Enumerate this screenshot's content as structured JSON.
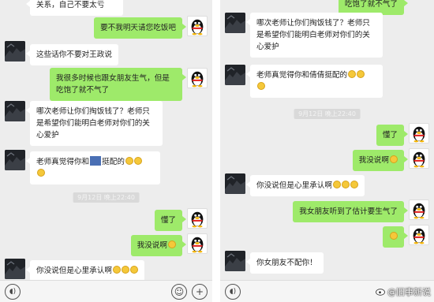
{
  "left": {
    "top_partial": "关系，自己不要太亏",
    "messages": [
      {
        "side": "right",
        "text": "要不我明天请您吃饭吧"
      },
      {
        "side": "left",
        "text": "这些话你不要对王政说"
      },
      {
        "side": "right",
        "text": "我很多时候也跟女朋友生气，但是吃饱了就不气了"
      },
      {
        "side": "left",
        "text": "哪次老师让你们掏饭钱了？老师只是希望你们能明白老师对你们的关心爱护"
      },
      {
        "side": "left",
        "text_a": "老师真觉得你和",
        "text_b": "挺配的"
      },
      {
        "side": "right",
        "text": "懂了"
      },
      {
        "side": "right",
        "text": "我没说啊"
      },
      {
        "side": "left",
        "text": "你没说但是心里承认啊"
      }
    ],
    "timestamp": "9月12日 晚上22:40"
  },
  "right": {
    "top_partial": "吃饱了就不气了",
    "messages": [
      {
        "side": "left",
        "text": "哪次老师让你们掏饭钱了？老师只是希望你们能明白老师对你们的关心爱护"
      },
      {
        "side": "left",
        "text": "老师真觉得你和倩倩挺配的"
      },
      {
        "side": "right",
        "text": "懂了"
      },
      {
        "side": "right",
        "text": "我没说啊"
      },
      {
        "side": "left",
        "text": "你没说但是心里承认啊"
      },
      {
        "side": "right",
        "text": "我女朋友听到了估计要生气了"
      },
      {
        "side": "left",
        "text": "你女朋友不配你！"
      }
    ],
    "timestamp": "9月12日 晚上22:40"
  },
  "watermark": "@旧事新说"
}
